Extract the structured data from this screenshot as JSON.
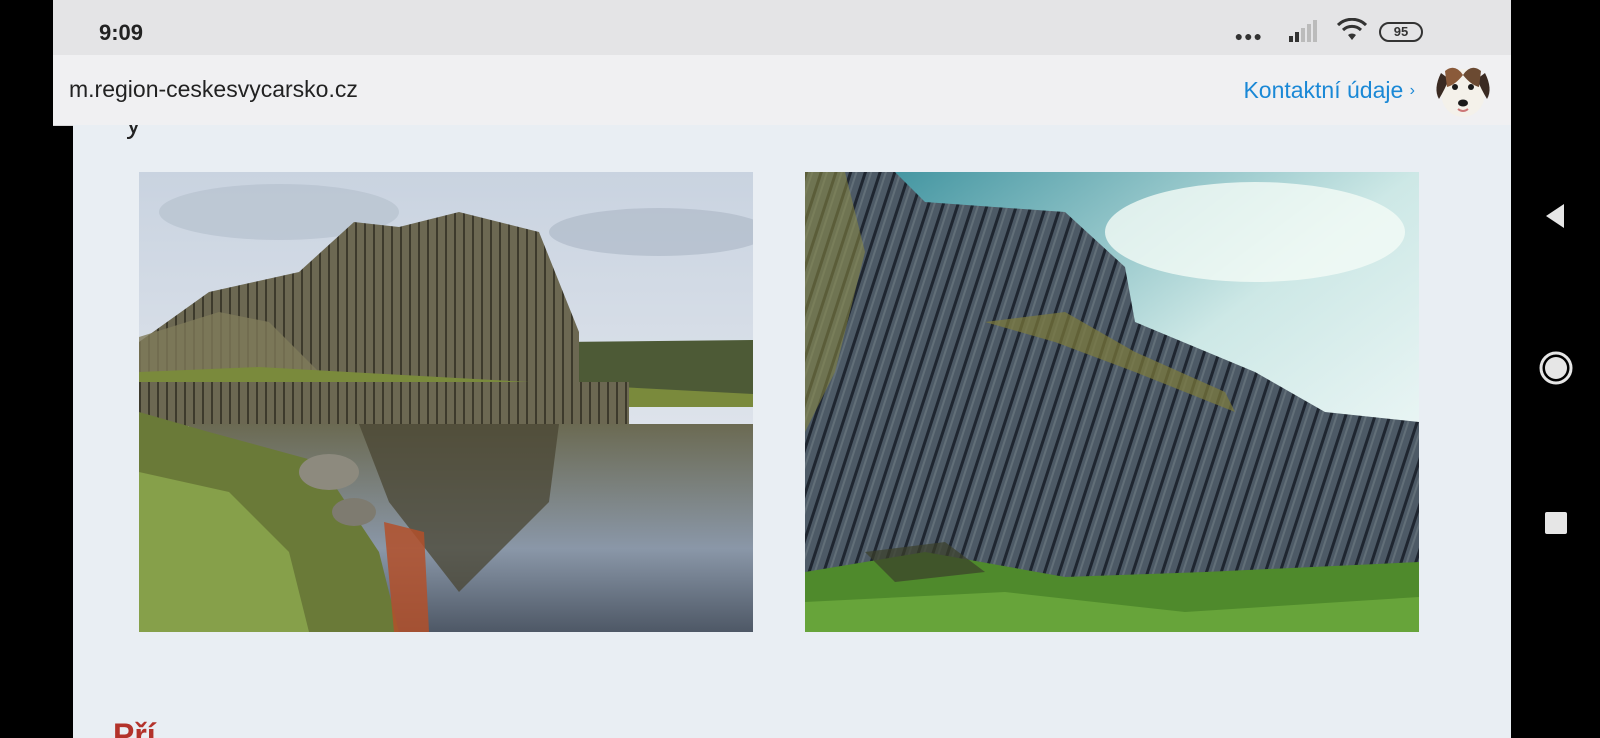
{
  "status_bar": {
    "time": "9:09",
    "battery": "95",
    "icons": [
      "more-dots-icon",
      "signal-icon",
      "wifi-icon",
      "battery-icon"
    ]
  },
  "browser": {
    "url": "m.region-ceskesvycarsko.cz",
    "contact_link": "Kontaktní údaje",
    "contact_chevron": "›",
    "avatar_icon": "dog-avatar-icon"
  },
  "content": {
    "partial_heading": "y",
    "partial_red_heading": "Pří",
    "photos": [
      {
        "subject": "basalt columns rock formation reflected in a pond"
      },
      {
        "subject": "basalt column rock wall above green grass"
      }
    ]
  },
  "android_nav": {
    "icons": [
      "back-icon",
      "home-icon",
      "recents-icon"
    ]
  },
  "colors": {
    "link": "#1a88d6",
    "page_bg": "#e9eef3",
    "heading_red": "#b3322a"
  }
}
